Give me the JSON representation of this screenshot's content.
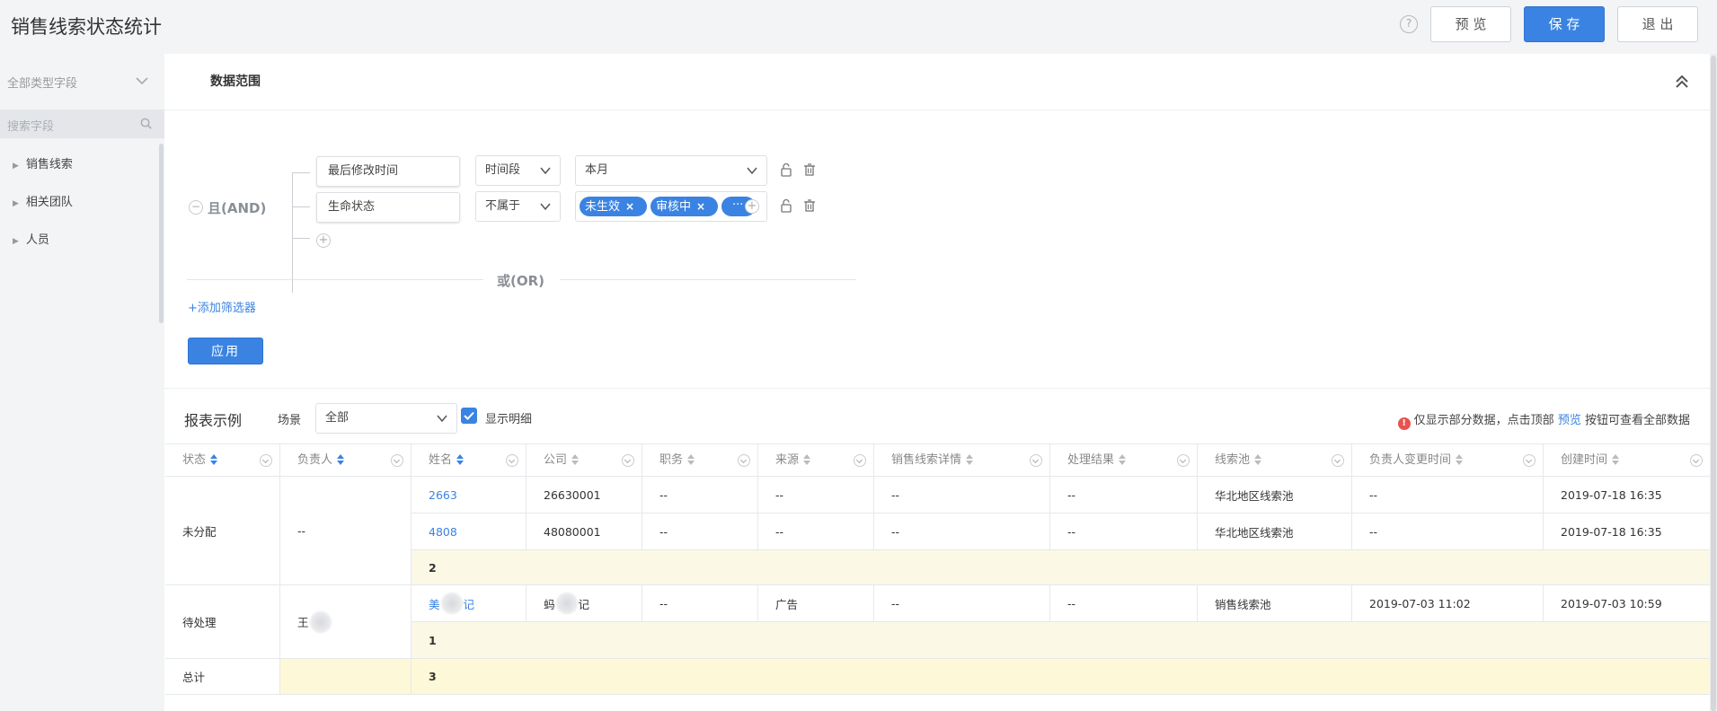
{
  "header": {
    "title": "销售线索状态统计",
    "help_glyph": "?",
    "preview_label": "预 览",
    "save_label": "保 存",
    "exit_label": "退 出"
  },
  "sidebar": {
    "filter_label": "全部类型字段",
    "search_placeholder": "搜索字段",
    "items": [
      {
        "label": "销售线索"
      },
      {
        "label": "相关团队"
      },
      {
        "label": "人员"
      }
    ]
  },
  "data_range": {
    "title": "数据范围",
    "and_label": "且(AND)",
    "or_label": "或(OR)",
    "conditions": [
      {
        "field": "最后修改时间",
        "operator": "时间段",
        "value": "本月"
      },
      {
        "field": "生命状态",
        "operator": "不属于",
        "tags": [
          "未生效",
          "审核中"
        ],
        "more": "···"
      }
    ],
    "add_filter_label": "+添加筛选器",
    "apply_label": "应用"
  },
  "report": {
    "title": "报表示例",
    "scene_label": "场景",
    "scene_value": "全部",
    "show_detail_label": "显示明细",
    "show_detail_checked": true,
    "notice_prefix": "仅显示部分数据，点击顶部",
    "notice_link": "预览",
    "notice_suffix": "按钮可查看全部数据"
  },
  "table": {
    "columns": [
      "状态",
      "负责人",
      "姓名",
      "公司",
      "职务",
      "来源",
      "销售线索详情",
      "处理结果",
      "线索池",
      "负责人变更时间",
      "创建时间"
    ],
    "groups": [
      {
        "status": "未分配",
        "owner": "--",
        "rows": [
          {
            "name": "2663",
            "company": "26630001",
            "title": "--",
            "source": "--",
            "detail": "--",
            "result": "--",
            "pool": "华北地区线索池",
            "owner_change": "--",
            "created": "2019-07-18 16:35"
          },
          {
            "name": "4808",
            "company": "48080001",
            "title": "--",
            "source": "--",
            "detail": "--",
            "result": "--",
            "pool": "华北地区线索池",
            "owner_change": "--",
            "created": "2019-07-18 16:35"
          }
        ],
        "subtotal": "2"
      },
      {
        "status": "待处理",
        "owner": "王",
        "rows": [
          {
            "name": "美",
            "name_suffix": "记",
            "company": "蚂",
            "company_suffix": "记",
            "title": "--",
            "source": "广告",
            "detail": "--",
            "result": "--",
            "pool": "销售线索池",
            "owner_change": "2019-07-03 11:02",
            "created": "2019-07-03 10:59"
          }
        ],
        "subtotal": "1"
      }
    ],
    "total_label": "总计",
    "total_value": "3"
  },
  "colors": {
    "accent": "#3a83e3",
    "subtotal_bg": "#fbf9e6",
    "total_bg": "#fdf8d7",
    "warning": "#e9534f"
  }
}
